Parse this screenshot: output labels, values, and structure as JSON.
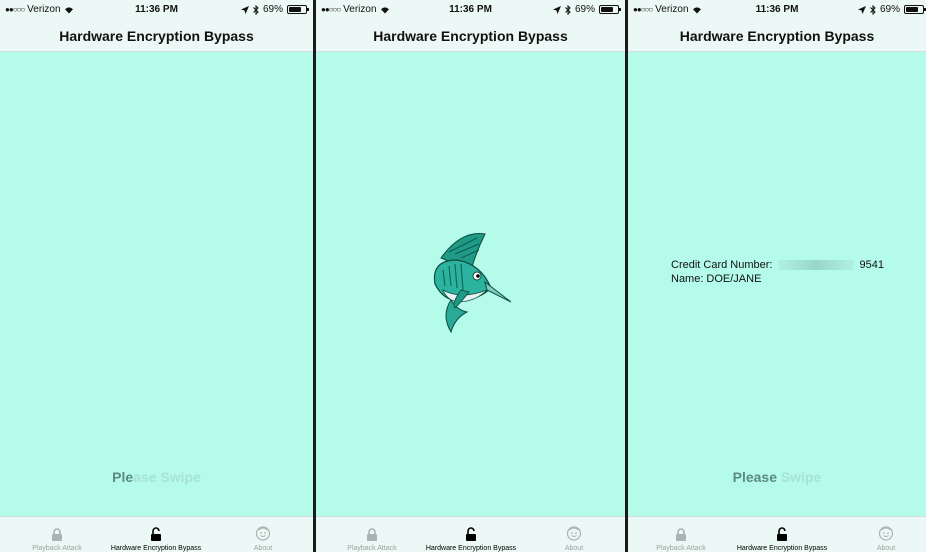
{
  "status": {
    "carrier": "Verizon",
    "time": "11:36 PM",
    "battery": "69%"
  },
  "nav": {
    "title": "Hardware Encryption Bypass"
  },
  "swipe": {
    "prefix": "Ple",
    "suffix": "ase Swipe",
    "prefix3": "Please",
    "suffix3": " Swipe"
  },
  "tabs": {
    "playback": "Playback Attack",
    "hardware": "Hardware Encryption Bypass",
    "about": "About"
  },
  "card": {
    "number_label": "Credit Card Number:",
    "last4": "9541",
    "name_label": "Name:",
    "name_value": "DOE/JANE"
  },
  "icons": {
    "tab_playback": "lock-closed-icon",
    "tab_hardware": "lock-open-icon",
    "tab_about": "smiley-face-icon",
    "center": "swordfish-icon"
  },
  "colors": {
    "background": "#b4fbea",
    "bar": "#ecf8f5"
  }
}
